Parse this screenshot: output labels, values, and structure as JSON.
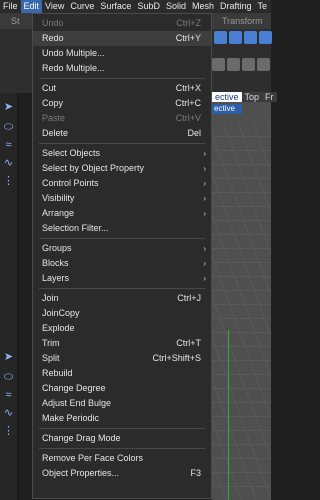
{
  "menubar": [
    "File",
    "Edit",
    "View",
    "Curve",
    "Surface",
    "SubD",
    "Solid",
    "Mesh",
    "Drafting",
    "Te"
  ],
  "background": {
    "tab_left": "St",
    "tab_right": "Transform",
    "viewport_tabs": [
      "ective",
      "Top",
      "Fr"
    ],
    "viewport_label": "ective"
  },
  "menu": {
    "items": [
      {
        "label": "Undo",
        "shortcut": "Ctrl+Z",
        "disabled": true
      },
      {
        "label": "Redo",
        "shortcut": "Ctrl+Y",
        "highlight": true
      },
      {
        "label": "Undo Multiple...",
        "shortcut": ""
      },
      {
        "label": "Redo Multiple...",
        "shortcut": ""
      },
      {
        "sep": true
      },
      {
        "label": "Cut",
        "shortcut": "Ctrl+X"
      },
      {
        "label": "Copy",
        "shortcut": "Ctrl+C"
      },
      {
        "label": "Paste",
        "shortcut": "Ctrl+V",
        "disabled": true
      },
      {
        "label": "Delete",
        "shortcut": "Del"
      },
      {
        "sep": true
      },
      {
        "label": "Select Objects",
        "submenu": true
      },
      {
        "label": "Select by Object Property",
        "submenu": true
      },
      {
        "label": "Control Points",
        "submenu": true
      },
      {
        "label": "Visibility",
        "submenu": true
      },
      {
        "label": "Arrange",
        "submenu": true
      },
      {
        "label": "Selection Filter...",
        "shortcut": ""
      },
      {
        "sep": true
      },
      {
        "label": "Groups",
        "submenu": true
      },
      {
        "label": "Blocks",
        "submenu": true
      },
      {
        "label": "Layers",
        "submenu": true
      },
      {
        "sep": true
      },
      {
        "label": "Join",
        "shortcut": "Ctrl+J"
      },
      {
        "label": "JoinCopy",
        "shortcut": ""
      },
      {
        "label": "Explode",
        "shortcut": ""
      },
      {
        "label": "Trim",
        "shortcut": "Ctrl+T"
      },
      {
        "label": "Split",
        "shortcut": "Ctrl+Shift+S"
      },
      {
        "label": "Rebuild",
        "shortcut": ""
      },
      {
        "label": "Change Degree",
        "shortcut": ""
      },
      {
        "label": "Adjust End Bulge",
        "shortcut": ""
      },
      {
        "label": "Make Periodic",
        "shortcut": ""
      },
      {
        "sep": true
      },
      {
        "label": "Change Drag Mode",
        "shortcut": ""
      },
      {
        "sep": true
      },
      {
        "label": "Remove Per Face Colors",
        "shortcut": ""
      },
      {
        "label": "Object Properties...",
        "shortcut": "F3"
      }
    ]
  }
}
